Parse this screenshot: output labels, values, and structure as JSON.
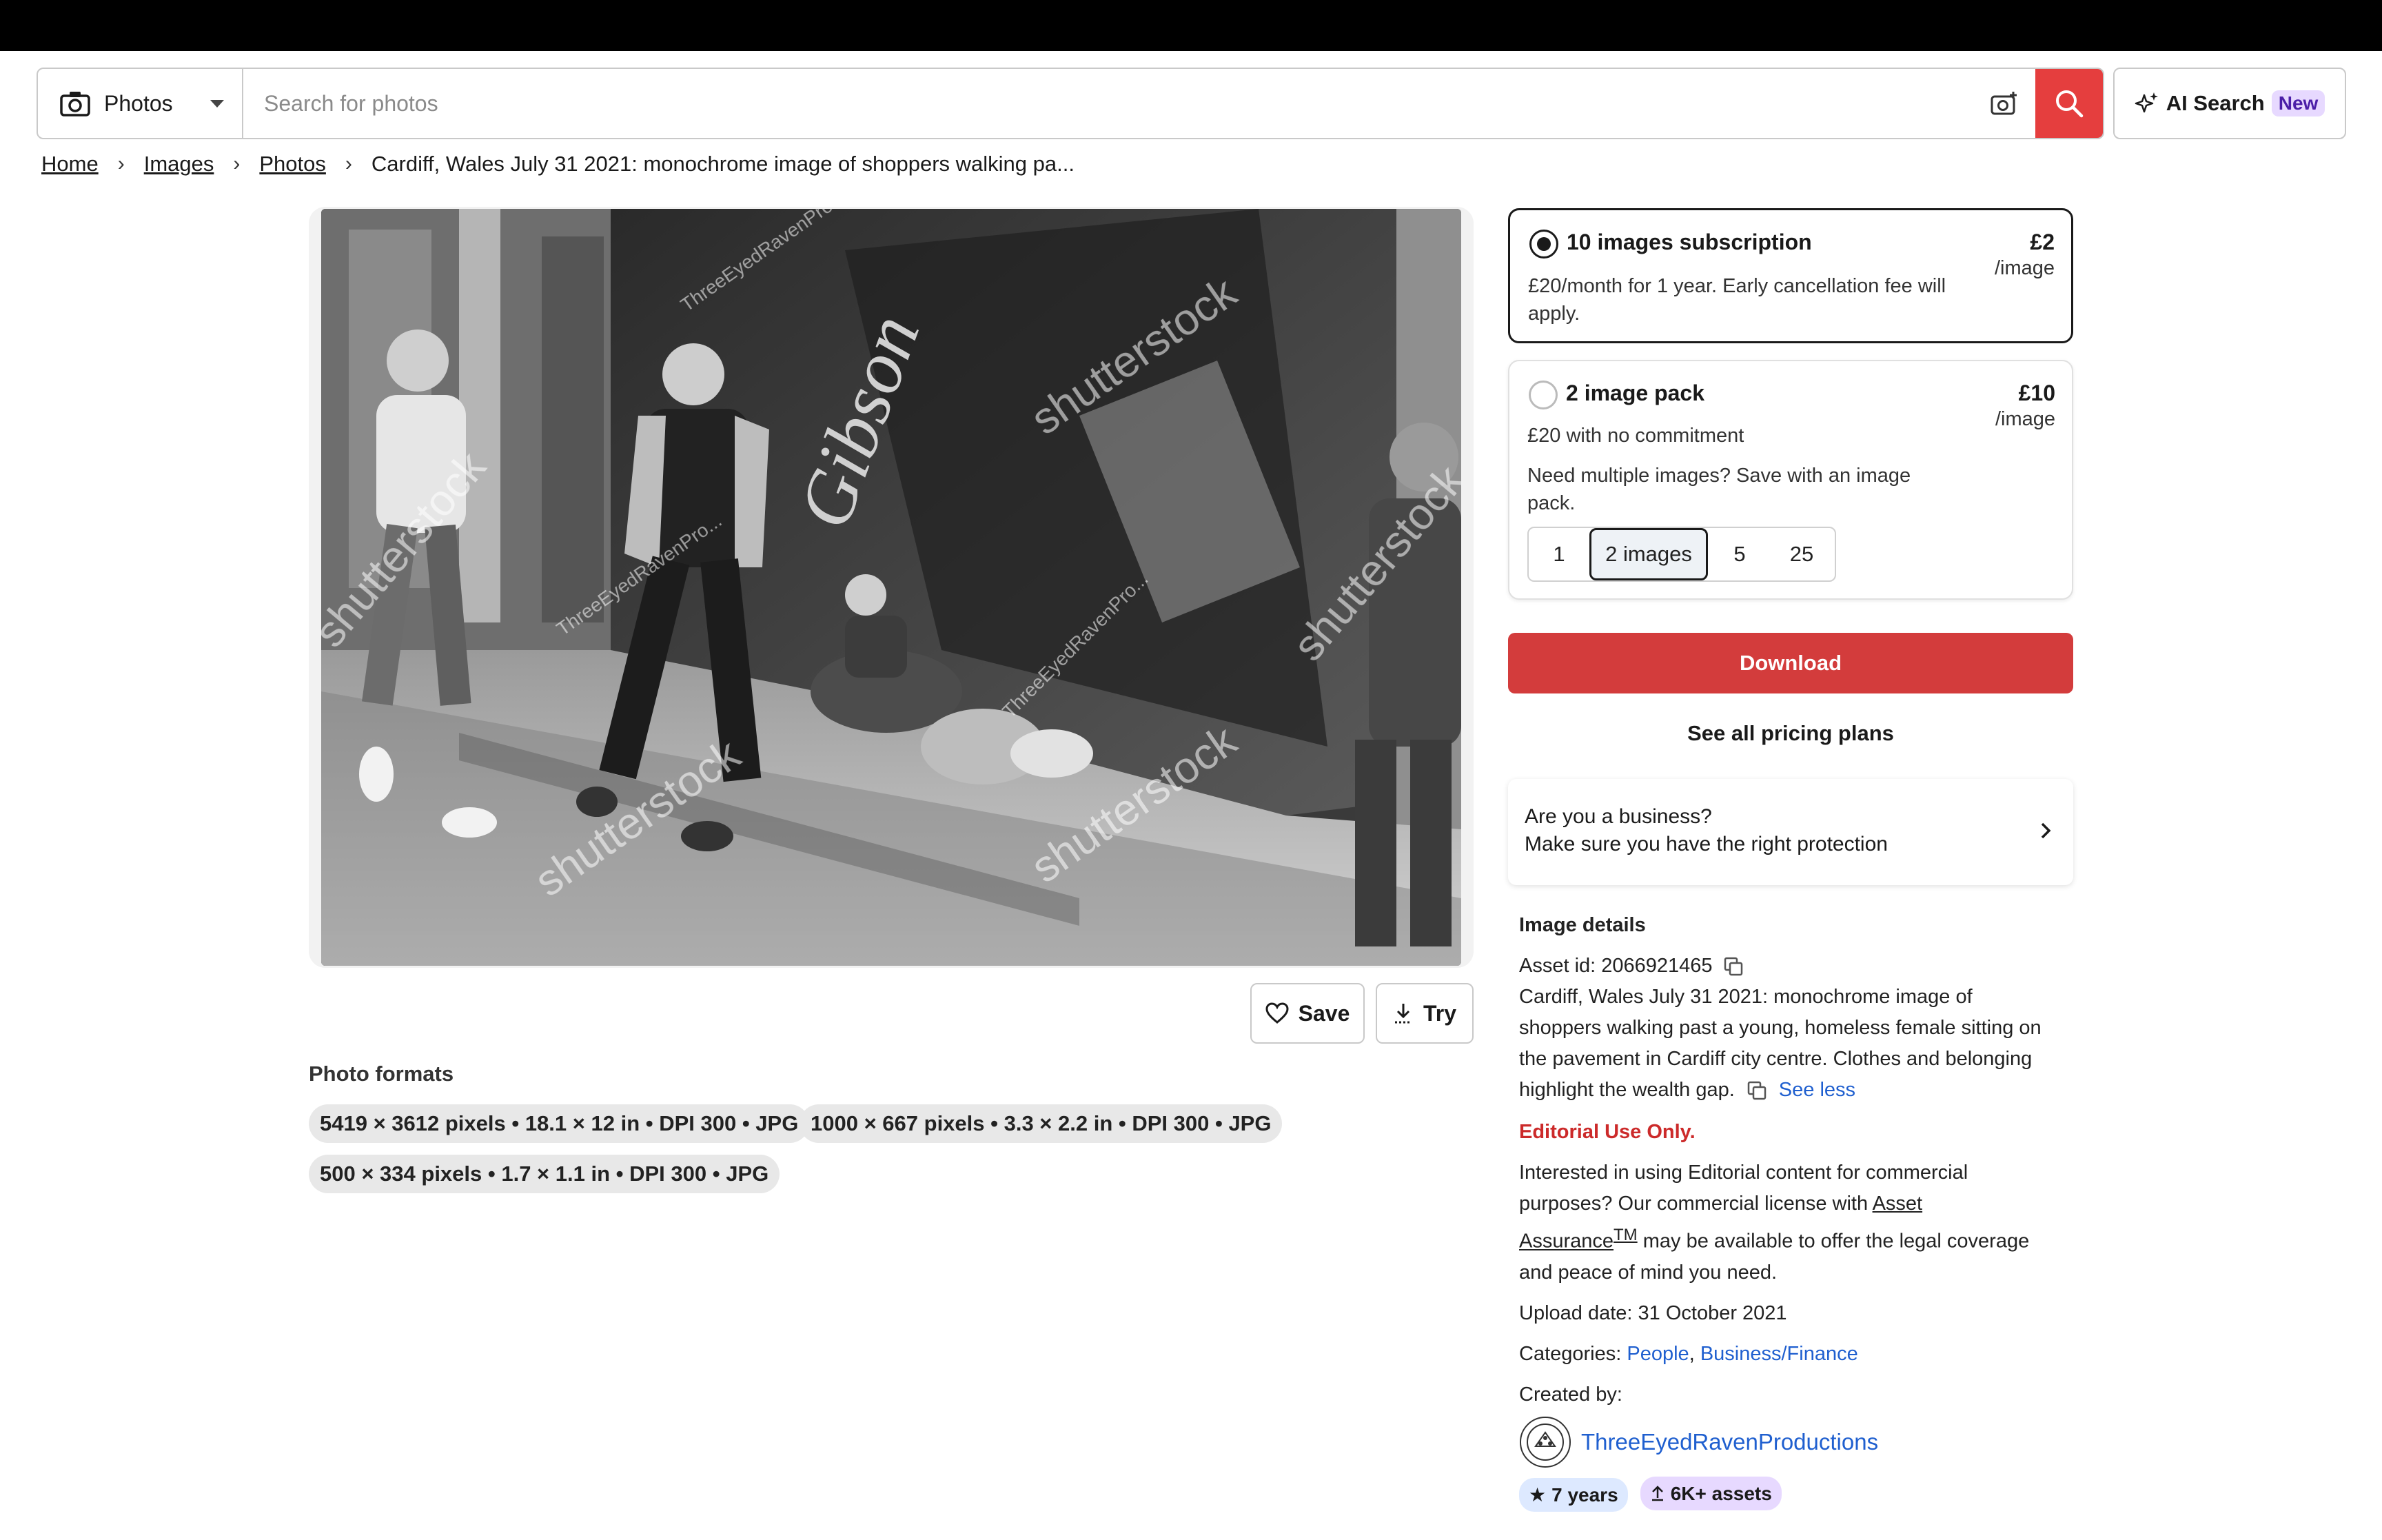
{
  "search": {
    "type_label": "Photos",
    "placeholder": "Search for photos",
    "ai_label": "AI Search",
    "ai_badge": "New"
  },
  "breadcrumb": [
    "Home",
    "Images",
    "Photos",
    "Cardiff, Wales July 31 2021: monochrome image of shoppers walking pa..."
  ],
  "image": {
    "watermark": "shutterstock",
    "contributor_watermark": "ThreeEyedRavenPro..."
  },
  "actions": {
    "save_label": "Save",
    "try_label": "Try"
  },
  "formats": {
    "title": "Photo formats",
    "items": [
      "5419 × 3612 pixels • 18.1 × 12 in • DPI 300 • JPG",
      "1000 × 667 pixels • 3.3 × 2.2 in • DPI 300 • JPG",
      "500 × 334 pixels • 1.7 × 1.1 in • DPI 300 • JPG"
    ]
  },
  "plans": [
    {
      "title": "10 images subscription",
      "price": "£2",
      "unit": "/image",
      "desc1": "£20/month for 1 year. Early cancellation fee will",
      "desc2": "apply."
    },
    {
      "title": "2 image pack",
      "price": "£10",
      "unit": "/image",
      "desc1": "£20 with no commitment",
      "desc2": "Need multiple images? Save with an image",
      "desc3": "pack.",
      "options": [
        "1",
        "2 images",
        "5",
        "25"
      ]
    }
  ],
  "download_label": "Download",
  "see_plans_label": "See all pricing plans",
  "business": {
    "line1": "Are you a business?",
    "line2": "Make sure you have the right protection"
  },
  "details": {
    "heading": "Image details",
    "asset_id": "Asset id: 2066921465",
    "description_lines": [
      "Cardiff, Wales July 31 2021: monochrome image of",
      "shoppers walking past a young, homeless female sitting on",
      "the pavement in Cardiff city centre. Clothes and belonging",
      "highlight the wealth gap."
    ],
    "see_less": "See less",
    "editorial": "Editorial Use Only.",
    "editorial_text_1": "Interested in using Editorial content for commercial",
    "editorial_text_2": "purposes? Our commercial license with",
    "asset_link": "Asset",
    "assurance": "Assurance",
    "tm": "TM",
    "editorial_text_3": "may be available to offer the legal coverage",
    "editorial_text_4": "and peace of mind you need.",
    "upload_date": "Upload date: 31 October 2021",
    "categories_label": "Categories:",
    "categories": [
      "People",
      "Business/Finance"
    ],
    "created_by": "Created by:",
    "author": "ThreeEyedRavenProductions",
    "years_badge": "7 years",
    "assets_badge": "6K+ assets"
  }
}
